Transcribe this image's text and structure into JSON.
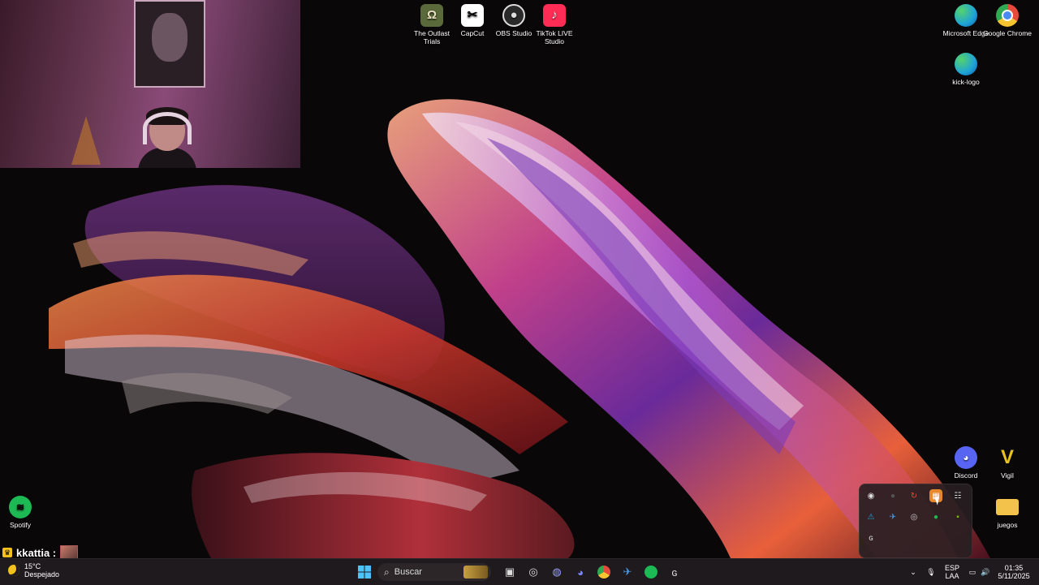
{
  "desktop_icons_top": [
    {
      "label": "The Outlast Trials",
      "icon": "outlast-icon",
      "color": "#5a6a3a"
    },
    {
      "label": "CapCut",
      "icon": "capcut-icon",
      "color": "#ffffff"
    },
    {
      "label": "OBS Studio",
      "icon": "obs-icon",
      "color": "#2a2a2a"
    },
    {
      "label": "TikTok LIVE Studio",
      "icon": "tiktok-icon",
      "color": "#ff2d55"
    }
  ],
  "desktop_icons_right": [
    {
      "label": "Microsoft Edge",
      "icon": "edge-icon",
      "color": "#1ea3d8"
    },
    {
      "label": "Google Chrome",
      "icon": "chrome-icon",
      "color": "#e64a3b"
    },
    {
      "label": "kick-logo",
      "icon": "kick-logo-icon",
      "color": "#1ea3d8"
    },
    {
      "label": "Discord",
      "icon": "discord-icon",
      "color": "#5865f2"
    },
    {
      "label": "Vigil",
      "icon": "vigil-icon",
      "color": "#e8c21a"
    },
    {
      "label": "juegos",
      "icon": "folder-icon",
      "color": "#f2c24a"
    }
  ],
  "desktop_icons_left": [
    {
      "label": "Spotify",
      "icon": "spotify-icon",
      "color": "#1db954"
    }
  ],
  "stream_overlay": {
    "username": "kkattia :"
  },
  "tray_overflow_icons": [
    "steam-icon",
    "nvidia-icon",
    "sync-icon",
    "app-orange-icon",
    "app-grid-icon",
    "network-warning-icon",
    "steam-blue-icon",
    "ubisoft-icon",
    "spotify-tray-icon",
    "nvidia-green-icon",
    "logitech-icon"
  ],
  "taskbar": {
    "search_placeholder": "Buscar",
    "weather_temp": "15°C",
    "weather_desc": "Despejado",
    "lang_top": "ESP",
    "lang_bottom": "LAA",
    "time": "01:35",
    "date": "5/11/2025"
  },
  "colors": {
    "taskbar_bg": "#1f1a1d",
    "accent": "#0078d4"
  }
}
